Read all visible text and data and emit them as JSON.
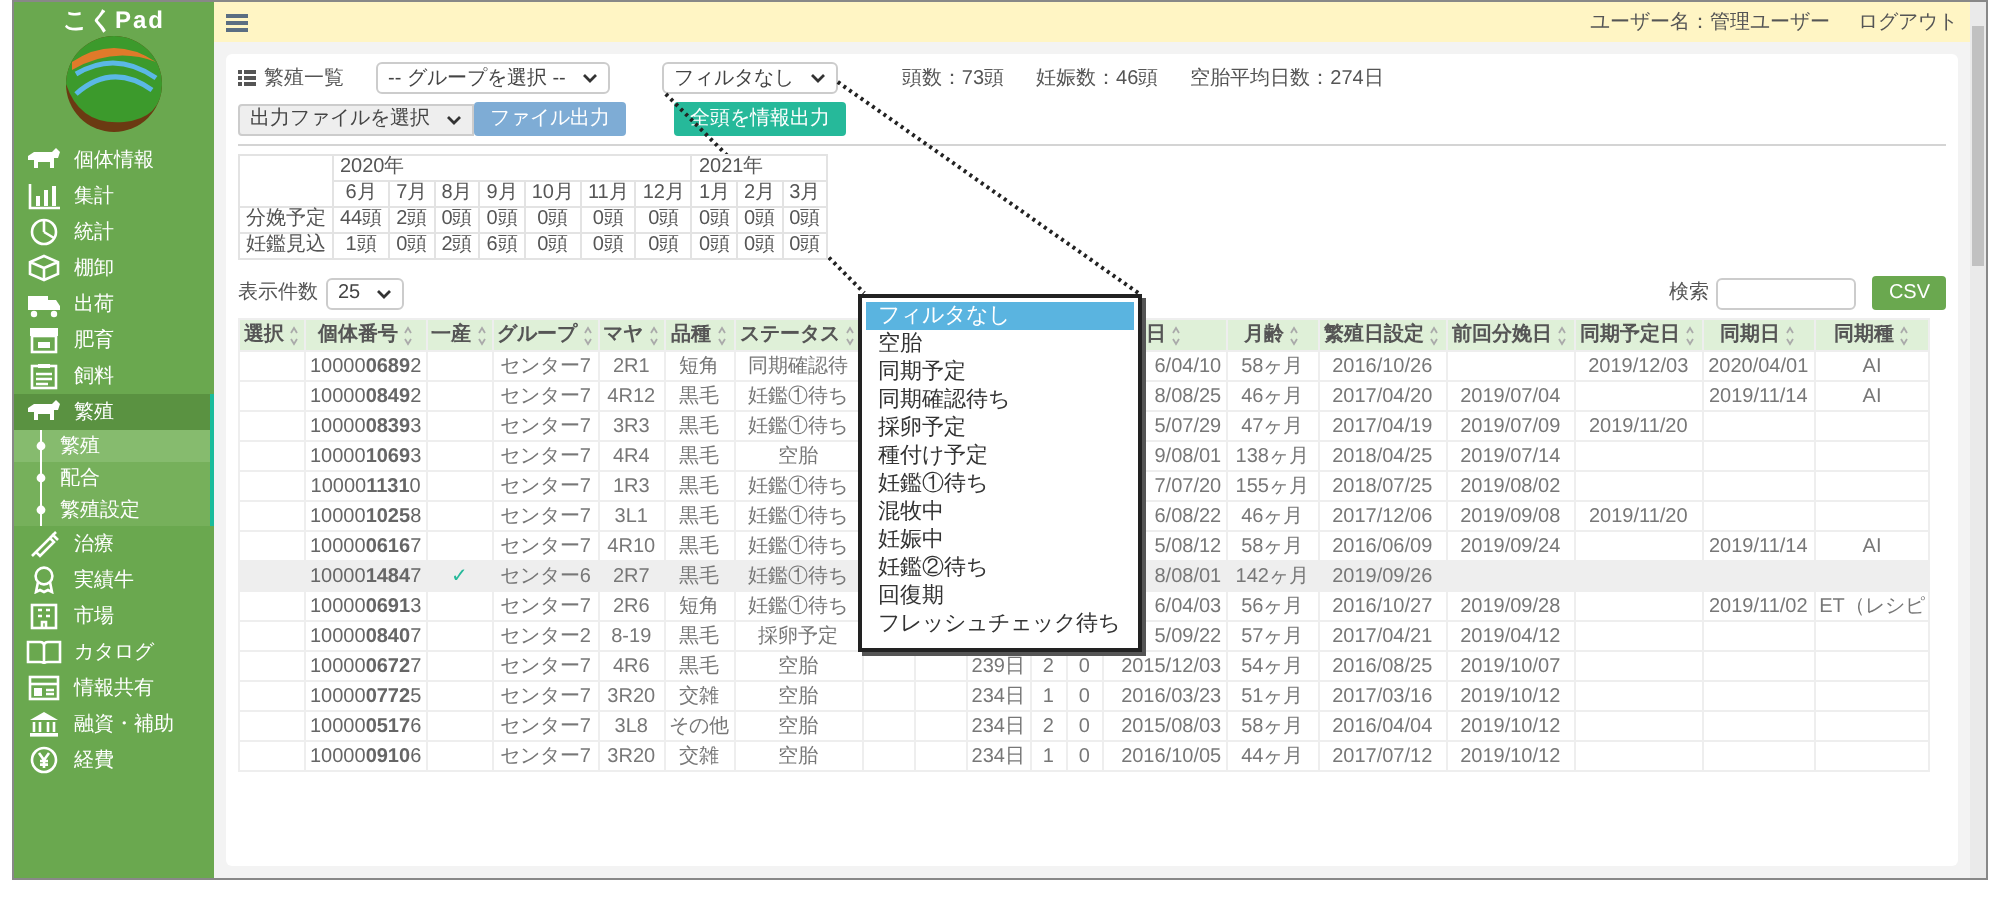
{
  "logo": {
    "text": "こくPad"
  },
  "sidebar": {
    "items": [
      {
        "label": "個体情報",
        "selected": false
      },
      {
        "label": "集計",
        "selected": false
      },
      {
        "label": "統計",
        "selected": false
      },
      {
        "label": "棚卸",
        "selected": false
      },
      {
        "label": "出荷",
        "selected": false
      },
      {
        "label": "肥育",
        "selected": false
      },
      {
        "label": "飼料",
        "selected": false
      },
      {
        "label": "繁殖",
        "selected": true,
        "expanded": true,
        "children": [
          {
            "label": "繁殖",
            "selected": true
          },
          {
            "label": "配合",
            "selected": false
          },
          {
            "label": "繁殖設定",
            "selected": false
          }
        ]
      },
      {
        "label": "治療",
        "selected": false
      },
      {
        "label": "実績牛",
        "selected": false
      },
      {
        "label": "市場",
        "selected": false
      },
      {
        "label": "カタログ",
        "selected": false
      },
      {
        "label": "情報共有",
        "selected": false
      },
      {
        "label": "融資・補助",
        "selected": false
      },
      {
        "label": "経費",
        "selected": false
      }
    ]
  },
  "topbar": {
    "user": "ユーザー名：管理ユーザー",
    "logout": "ログアウト"
  },
  "panel": {
    "title": "繁殖一覧",
    "group_select": "-- グループを選択 --",
    "filter_select": "フィルタなし",
    "stats": [
      "頭数：73頭",
      "妊娠数：46頭",
      "空胎平均日数：274日"
    ],
    "output_select": "出力ファイルを選択",
    "file_button": "ファイル出力",
    "export_button": "全頭を情報出力"
  },
  "forecast": {
    "years": [
      {
        "label": "2020年",
        "months": [
          "6月",
          "7月",
          "8月",
          "9月",
          "10月",
          "11月",
          "12月"
        ]
      },
      {
        "label": "2021年",
        "months": [
          "1月",
          "2月",
          "3月"
        ]
      }
    ],
    "rows": [
      {
        "label": "分娩予定",
        "values": [
          "44頭",
          "2頭",
          "0頭",
          "0頭",
          "0頭",
          "0頭",
          "0頭",
          "0頭",
          "0頭",
          "0頭"
        ]
      },
      {
        "label": "妊鑑見込",
        "values": [
          "1頭",
          "0頭",
          "2頭",
          "6頭",
          "0頭",
          "0頭",
          "0頭",
          "0頭",
          "0頭",
          "0頭"
        ]
      }
    ]
  },
  "table_controls": {
    "page_size_label": "表示件数",
    "page_size": "25",
    "search_label": "検索",
    "csv_button": "CSV"
  },
  "table": {
    "columns": [
      "選択",
      "個体番号",
      "一産",
      "グループ",
      "マヤ",
      "品種",
      "ステータス",
      null,
      null,
      null,
      null,
      null,
      "日",
      "月齢",
      "繁殖日設定",
      "前回分娩日",
      "同期予定日",
      "同期日",
      "同期種"
    ],
    "rows": [
      {
        "selected": false,
        "cells": [
          null,
          "10000**0689**2",
          null,
          "センター7",
          "2R1",
          "短角",
          "同期確認待",
          null,
          null,
          null,
          null,
          null,
          "6/04/10",
          "58ヶ月",
          "2016/10/26",
          null,
          "2019/12/03",
          "2020/04/01",
          "AI"
        ]
      },
      {
        "selected": false,
        "cells": [
          null,
          "10000**0849**2",
          null,
          "センター7",
          "4R12",
          "黒毛",
          "妊鑑①待ち",
          null,
          null,
          null,
          null,
          null,
          "8/08/25",
          "46ヶ月",
          "2017/04/20",
          "2019/07/04",
          null,
          "2019/11/14",
          "AI"
        ]
      },
      {
        "selected": false,
        "cells": [
          null,
          "10000**0839**3",
          null,
          "センター7",
          "3R3",
          "黒毛",
          "妊鑑①待ち",
          null,
          null,
          null,
          null,
          null,
          "5/07/29",
          "47ヶ月",
          "2017/04/19",
          "2019/07/09",
          "2019/11/20",
          null,
          null
        ]
      },
      {
        "selected": false,
        "cells": [
          null,
          "10000**1069**3",
          null,
          "センター7",
          "4R4",
          "黒毛",
          "空胎",
          null,
          null,
          null,
          null,
          null,
          "9/08/01",
          "138ヶ月",
          "2018/04/25",
          "2019/07/14",
          null,
          null,
          null
        ]
      },
      {
        "selected": false,
        "cells": [
          null,
          "10000**1131**0",
          null,
          "センター7",
          "1R3",
          "黒毛",
          "妊鑑①待ち",
          null,
          null,
          null,
          null,
          null,
          "7/07/20",
          "155ヶ月",
          "2018/07/25",
          "2019/08/02",
          null,
          null,
          null
        ]
      },
      {
        "selected": false,
        "cells": [
          null,
          "10000**1025**8",
          null,
          "センター7",
          "3L1",
          "黒毛",
          "妊鑑①待ち",
          null,
          null,
          null,
          null,
          null,
          "6/08/22",
          "46ヶ月",
          "2017/12/06",
          "2019/09/08",
          "2019/11/20",
          null,
          null
        ]
      },
      {
        "selected": false,
        "cells": [
          null,
          "10000**0616**7",
          null,
          "センター7",
          "4R10",
          "黒毛",
          "妊鑑①待ち",
          null,
          null,
          null,
          null,
          null,
          "5/08/12",
          "58ヶ月",
          "2016/06/09",
          "2019/09/24",
          null,
          "2019/11/14",
          "AI"
        ]
      },
      {
        "selected": true,
        "cells": [
          null,
          "10000**1484**7",
          "✓",
          "センター6",
          "2R7",
          "黒毛",
          "妊鑑①待ち",
          null,
          null,
          null,
          null,
          null,
          "8/08/01",
          "142ヶ月",
          "2019/09/26",
          null,
          null,
          null,
          null
        ]
      },
      {
        "selected": false,
        "cells": [
          null,
          "10000**0691**3",
          null,
          "センター7",
          "2R6",
          "短角",
          "妊鑑①待ち",
          null,
          null,
          null,
          null,
          null,
          "6/04/03",
          "56ヶ月",
          "2016/10/27",
          "2019/09/28",
          null,
          "2019/11/02",
          "ET（レシピ"
        ]
      },
      {
        "selected": false,
        "cells": [
          null,
          "10000**0840**7",
          null,
          "センター2",
          "8-19",
          "黒毛",
          "採卵予定",
          null,
          null,
          null,
          null,
          null,
          "5/09/22",
          "57ヶ月",
          "2017/04/21",
          "2019/04/12",
          null,
          null,
          null
        ]
      },
      {
        "selected": false,
        "cells": [
          null,
          "10000**0672**7",
          null,
          "センター7",
          "4R6",
          "黒毛",
          "空胎",
          null,
          null,
          "239日",
          "2",
          "0",
          "2015/12/03",
          "54ヶ月",
          "2016/08/25",
          "2019/10/07",
          null,
          null,
          null
        ]
      },
      {
        "selected": false,
        "cells": [
          null,
          "10000**0772**5",
          null,
          "センター7",
          "3R20",
          "交雑",
          "空胎",
          null,
          null,
          "234日",
          "1",
          "0",
          "2016/03/23",
          "51ヶ月",
          "2017/03/16",
          "2019/10/12",
          null,
          null,
          null
        ]
      },
      {
        "selected": false,
        "cells": [
          null,
          "10000**0517**6",
          null,
          "センター7",
          "3L8",
          "その他",
          "空胎",
          null,
          null,
          "234日",
          "2",
          "0",
          "2015/08/03",
          "58ヶ月",
          "2016/04/04",
          "2019/10/12",
          null,
          null,
          null
        ]
      },
      {
        "selected": false,
        "cells": [
          null,
          "10000**0910**6",
          null,
          "センター7",
          "3R20",
          "交雑",
          "空胎",
          null,
          null,
          "234日",
          "1",
          "0",
          "2016/10/05",
          "44ヶ月",
          "2017/07/12",
          "2019/10/12",
          null,
          null,
          null
        ]
      }
    ]
  },
  "filter_dropdown": {
    "options": [
      {
        "label": "フィルタなし",
        "selected": true
      },
      {
        "label": "空胎",
        "selected": false
      },
      {
        "label": "同期予定",
        "selected": false
      },
      {
        "label": "同期確認待ち",
        "selected": false
      },
      {
        "label": "採卵予定",
        "selected": false
      },
      {
        "label": "種付け予定",
        "selected": false
      },
      {
        "label": "妊鑑①待ち",
        "selected": false
      },
      {
        "label": "混牧中",
        "selected": false
      },
      {
        "label": "妊娠中",
        "selected": false
      },
      {
        "label": "妊鑑②待ち",
        "selected": false
      },
      {
        "label": "回復期",
        "selected": false
      },
      {
        "label": "フレッシュチェック待ち",
        "selected": false
      }
    ]
  }
}
